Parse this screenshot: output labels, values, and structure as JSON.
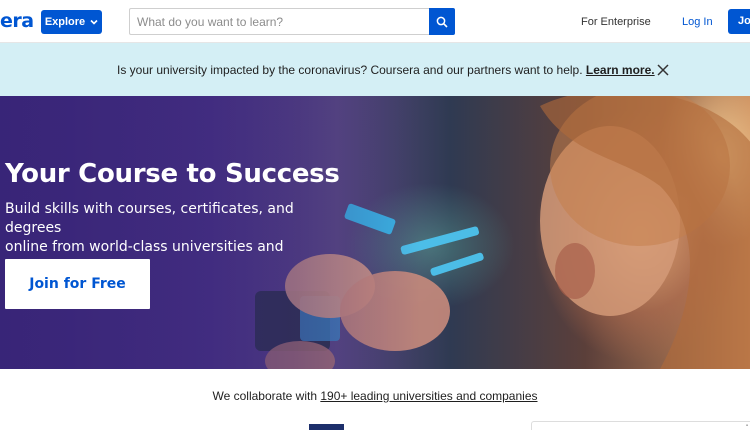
{
  "header": {
    "logo_text": "era",
    "explore_label": "Explore",
    "search_placeholder": "What do you want to learn?",
    "for_enterprise": "For Enterprise",
    "login": "Log In",
    "join": "Join"
  },
  "banner": {
    "text": "Is your university impacted by the coronavirus? Coursera and our partners want to help.",
    "link": "Learn more."
  },
  "hero": {
    "title": "Your Course to Success",
    "subtitle_line1": "Build skills with courses, certificates, and degrees",
    "subtitle_line2": "online from world-class universities and companies",
    "cta": "Join for Free"
  },
  "collab": {
    "prefix": "We collaborate with",
    "link": "190+ leading universities and companies"
  },
  "colors": {
    "brand_blue": "#0056d2",
    "banner_bg": "#d4eff5",
    "hero_purple": "#3d2a78"
  },
  "icons": {
    "explore": "chevron-down-icon",
    "search": "search-icon",
    "close": "close-icon"
  }
}
